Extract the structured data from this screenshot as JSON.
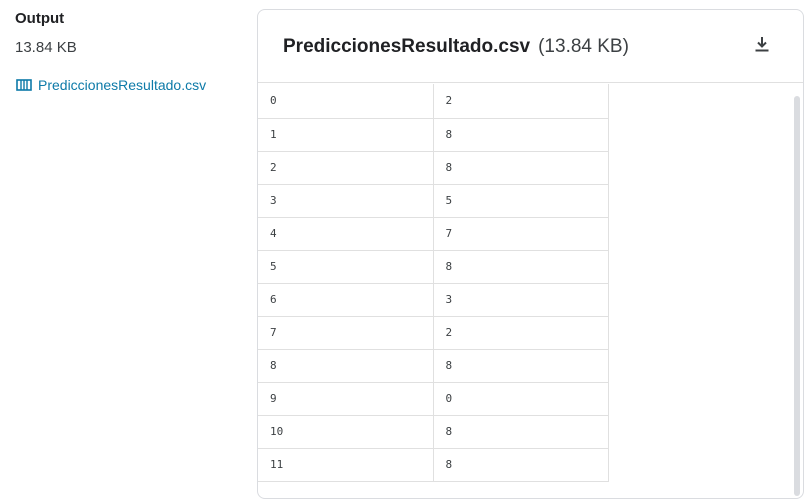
{
  "sidebar": {
    "title": "Output",
    "size": "13.84 KB",
    "file_link": "PrediccionesResultado.csv",
    "file_icon": "table-icon"
  },
  "panel": {
    "filename": "PrediccionesResultado.csv",
    "size": "(13.84 KB)",
    "download_icon": "download-icon"
  },
  "table": {
    "rows": [
      [
        "0",
        "2"
      ],
      [
        "1",
        "8"
      ],
      [
        "2",
        "8"
      ],
      [
        "3",
        "5"
      ],
      [
        "4",
        "7"
      ],
      [
        "5",
        "8"
      ],
      [
        "6",
        "3"
      ],
      [
        "7",
        "2"
      ],
      [
        "8",
        "8"
      ],
      [
        "9",
        "0"
      ],
      [
        "10",
        "8"
      ],
      [
        "11",
        "8"
      ]
    ]
  },
  "colors": {
    "link": "#0d7aa8",
    "border": "#dadce0"
  }
}
